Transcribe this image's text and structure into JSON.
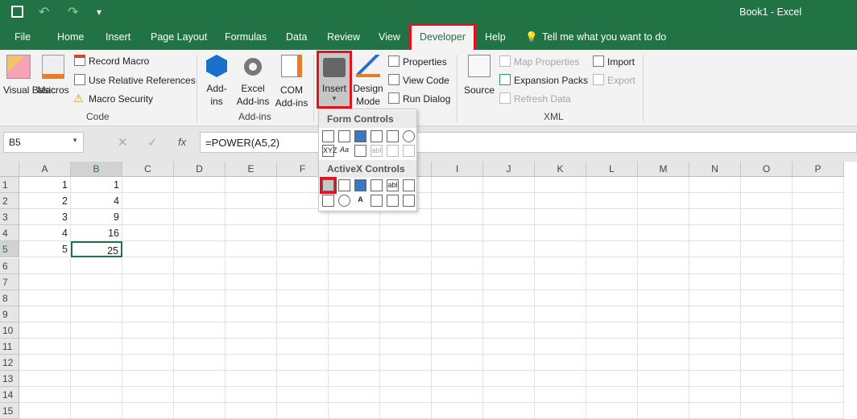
{
  "title": "Book1  -  Excel",
  "quick_access": {
    "save": "save-icon",
    "undo": "undo-icon",
    "redo": "redo-icon",
    "customize": "▾"
  },
  "tabs": [
    "File",
    "Home",
    "Insert",
    "Page Layout",
    "Formulas",
    "Data",
    "Review",
    "View",
    "Developer",
    "Help"
  ],
  "active_tab": "Developer",
  "tell_me": "Tell me what you want to do",
  "ribbon": {
    "code": {
      "label": "Code",
      "visual_basic": "Visual Basic",
      "macros": "Macros",
      "record_macro": "Record Macro",
      "relative_refs": "Use Relative References",
      "macro_security": "Macro Security"
    },
    "addins": {
      "label": "Add-ins",
      "addins": "Add-ins",
      "excel_addins": "Excel Add-ins",
      "com_addins": "COM Add-ins"
    },
    "controls": {
      "insert": "Insert",
      "design_mode": "Design Mode",
      "properties": "Properties",
      "view_code": "View Code",
      "run_dialog": "Run Dialog"
    },
    "xml": {
      "label": "XML",
      "source": "Source",
      "map_properties": "Map Properties",
      "expansion_packs": "Expansion Packs",
      "refresh_data": "Refresh Data",
      "import": "Import",
      "export": "Export"
    }
  },
  "insert_menu": {
    "form_controls": "Form Controls",
    "activex_controls": "ActiveX Controls",
    "aa": "Aa",
    "ab": "abl",
    "A": "A",
    "xyz": "XYZ"
  },
  "name_box": "B5",
  "formula": "=POWER(A5,2)",
  "fx": "fx",
  "columns": [
    "A",
    "B",
    "C",
    "D",
    "E",
    "F",
    "G",
    "H",
    "I",
    "J",
    "K",
    "L",
    "M",
    "N",
    "O",
    "P"
  ],
  "rows": [
    "1",
    "2",
    "3",
    "4",
    "5",
    "6",
    "7",
    "8",
    "9",
    "10",
    "11",
    "12",
    "13",
    "14",
    "15"
  ],
  "cells": {
    "A": [
      "1",
      "2",
      "3",
      "4",
      "5"
    ],
    "B": [
      "1",
      "4",
      "9",
      "16",
      "25"
    ]
  },
  "selected_cell": "B5",
  "colors": {
    "brand": "#217346",
    "highlight": "#e3121e"
  }
}
